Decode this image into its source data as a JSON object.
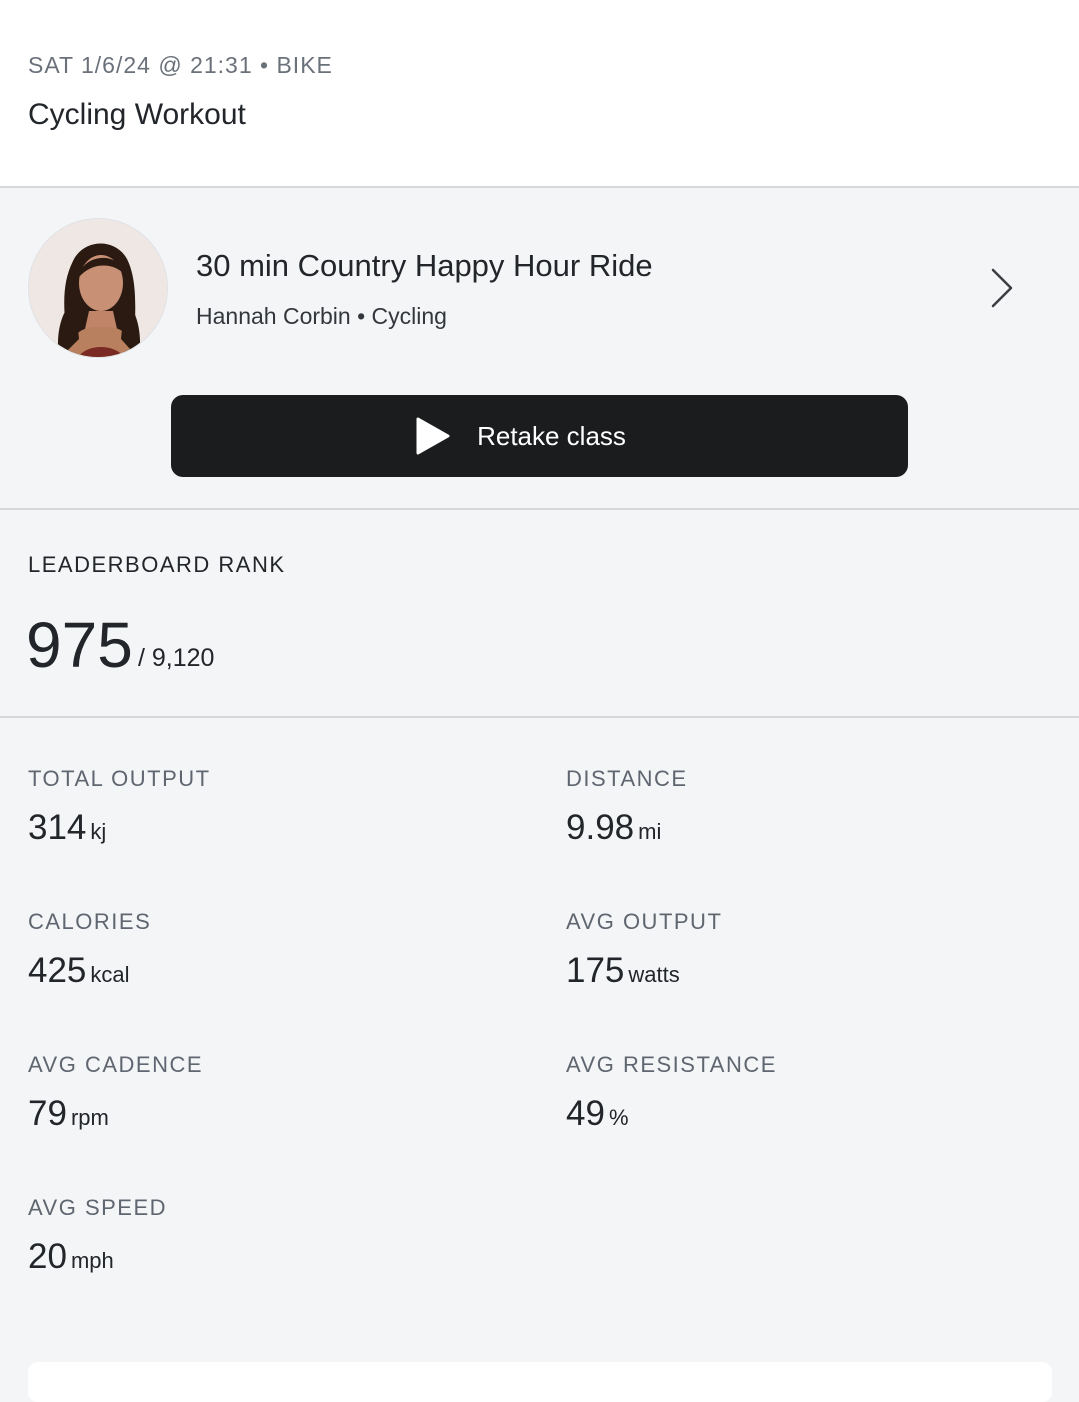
{
  "header": {
    "meta": "SAT 1/6/24 @ 21:31 • BIKE",
    "title": "Cycling Workout"
  },
  "class_info": {
    "name": "30 min Country Happy Hour Ride",
    "subtitle": "Hannah Corbin • Cycling",
    "retake_label": "Retake class"
  },
  "leaderboard": {
    "label": "LEADERBOARD RANK",
    "rank": "975",
    "total": "/ 9,120"
  },
  "stats": [
    {
      "label": "TOTAL OUTPUT",
      "value": "314",
      "unit": "kj"
    },
    {
      "label": "DISTANCE",
      "value": "9.98",
      "unit": "mi"
    },
    {
      "label": "CALORIES",
      "value": "425",
      "unit": "kcal"
    },
    {
      "label": "AVG OUTPUT",
      "value": "175",
      "unit": "watts"
    },
    {
      "label": "AVG CADENCE",
      "value": "79",
      "unit": "rpm"
    },
    {
      "label": "AVG RESISTANCE",
      "value": "49",
      "unit": "%"
    },
    {
      "label": "AVG SPEED",
      "value": "20",
      "unit": "mph"
    }
  ]
}
